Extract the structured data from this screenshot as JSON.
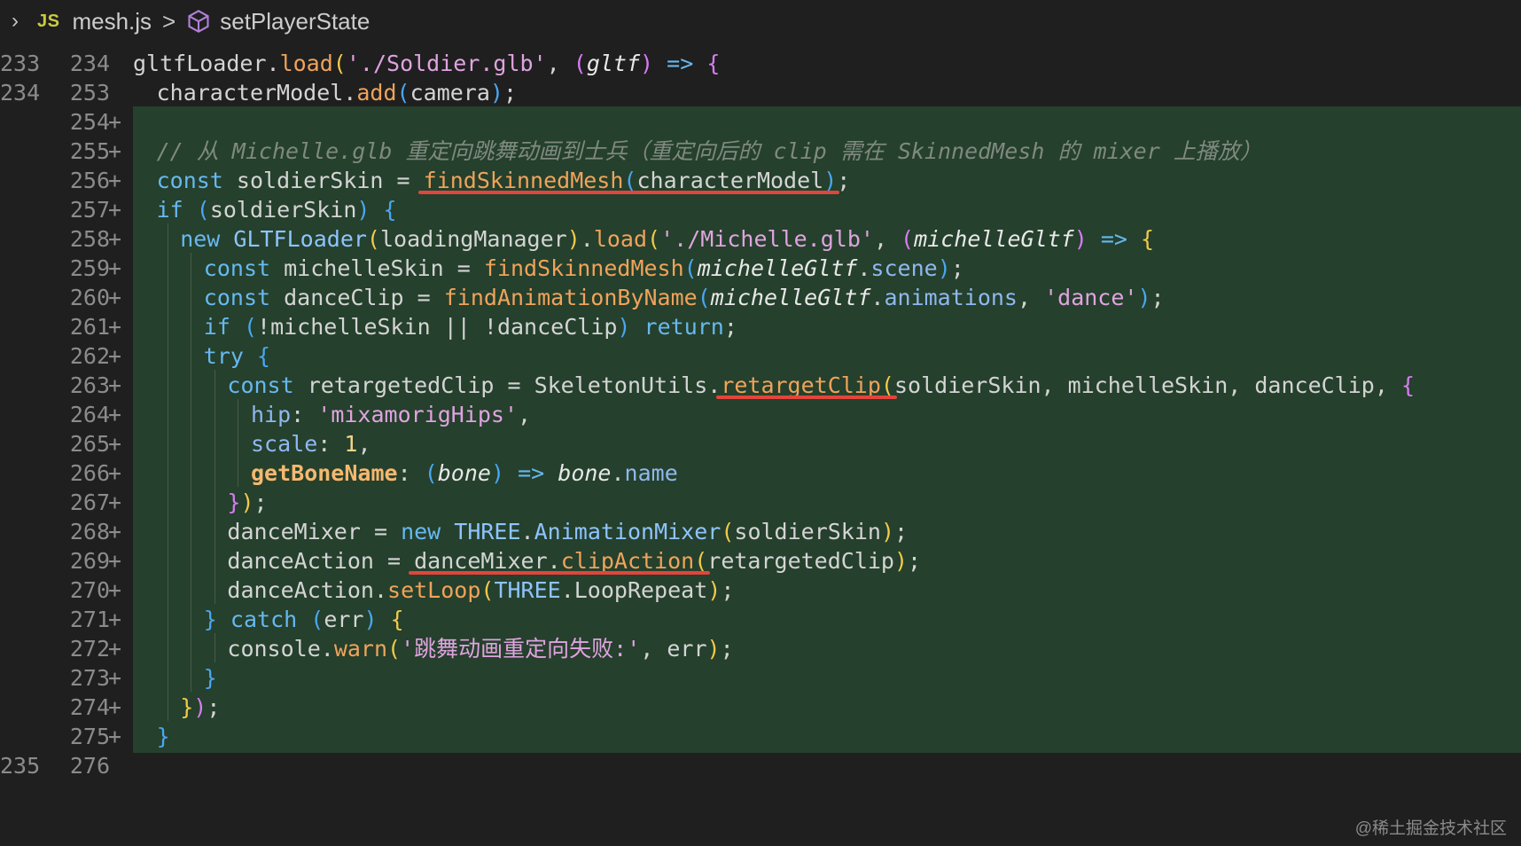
{
  "breadcrumb": {
    "file_badge": "JS",
    "file_name": "mesh.js",
    "separator": ">",
    "symbol_name": "setPlayerState",
    "symbol_icon": "cube-icon"
  },
  "colors": {
    "added_line_background": "#25402c",
    "annotation_underline": "#e2453c",
    "js_badge": "#cbcb41"
  },
  "lines": [
    {
      "old": "233",
      "new": "234",
      "plus": "",
      "added": false,
      "indent": 0,
      "tokens": [
        [
          "t-plain",
          "gltfLoader."
        ],
        [
          "t-method",
          "load"
        ],
        [
          "t-paren1",
          "("
        ],
        [
          "t-string",
          "'./Soldier.glb'"
        ],
        [
          "t-plain",
          ", "
        ],
        [
          "t-paren2",
          "("
        ],
        [
          "t-param",
          "gltf"
        ],
        [
          "t-paren2",
          ")"
        ],
        [
          "t-plain",
          " "
        ],
        [
          "t-kw",
          "=>"
        ],
        [
          "t-plain",
          " "
        ],
        [
          "t-paren2",
          "{"
        ]
      ]
    },
    {
      "old": "234",
      "new": "253",
      "plus": "",
      "added": false,
      "indent": 1,
      "tokens": [
        [
          "t-plain",
          "characterModel."
        ],
        [
          "t-method",
          "add"
        ],
        [
          "t-paren3",
          "("
        ],
        [
          "t-plain",
          "camera"
        ],
        [
          "t-paren3",
          ")"
        ],
        [
          "t-plain",
          ";"
        ]
      ]
    },
    {
      "old": "",
      "new": "254",
      "plus": "+",
      "added": true,
      "indent": 0,
      "tokens": []
    },
    {
      "old": "",
      "new": "255",
      "plus": "+",
      "added": true,
      "indent": 1,
      "tokens": [
        [
          "t-comment",
          "// 从 Michelle.glb 重定向跳舞动画到士兵（重定向后的 clip 需在 SkinnedMesh 的 mixer 上播放）"
        ]
      ]
    },
    {
      "old": "",
      "new": "256",
      "plus": "+",
      "added": true,
      "indent": 1,
      "tokens": [
        [
          "t-kw",
          "const"
        ],
        [
          "t-plain",
          " soldierSkin = "
        ],
        [
          "t-method",
          "findSkinnedMesh"
        ],
        [
          "t-paren3",
          "("
        ],
        [
          "t-plain",
          "characterModel"
        ],
        [
          "t-paren3",
          ")"
        ],
        [
          "t-plain",
          ";"
        ]
      ]
    },
    {
      "old": "",
      "new": "257",
      "plus": "+",
      "added": true,
      "indent": 1,
      "tokens": [
        [
          "t-kw",
          "if"
        ],
        [
          "t-plain",
          " "
        ],
        [
          "t-paren3",
          "("
        ],
        [
          "t-plain",
          "soldierSkin"
        ],
        [
          "t-paren3",
          ")"
        ],
        [
          "t-plain",
          " "
        ],
        [
          "t-paren3",
          "{"
        ]
      ]
    },
    {
      "old": "",
      "new": "258",
      "plus": "+",
      "added": true,
      "indent": 2,
      "tokens": [
        [
          "t-kw",
          "new"
        ],
        [
          "t-plain",
          " "
        ],
        [
          "t-class",
          "GLTFLoader"
        ],
        [
          "t-paren1",
          "("
        ],
        [
          "t-plain",
          "loadingManager"
        ],
        [
          "t-paren1",
          ")"
        ],
        [
          "t-plain",
          "."
        ],
        [
          "t-method",
          "load"
        ],
        [
          "t-paren1",
          "("
        ],
        [
          "t-string",
          "'./Michelle.glb'"
        ],
        [
          "t-plain",
          ", "
        ],
        [
          "t-paren2",
          "("
        ],
        [
          "t-param",
          "michelleGltf"
        ],
        [
          "t-paren2",
          ")"
        ],
        [
          "t-plain",
          " "
        ],
        [
          "t-kw",
          "=>"
        ],
        [
          "t-plain",
          " "
        ],
        [
          "t-paren1",
          "{"
        ]
      ]
    },
    {
      "old": "",
      "new": "259",
      "plus": "+",
      "added": true,
      "indent": 3,
      "tokens": [
        [
          "t-kw",
          "const"
        ],
        [
          "t-plain",
          " michelleSkin = "
        ],
        [
          "t-method",
          "findSkinnedMesh"
        ],
        [
          "t-paren3",
          "("
        ],
        [
          "t-param",
          "michelleGltf"
        ],
        [
          "t-plain",
          "."
        ],
        [
          "t-prop",
          "scene"
        ],
        [
          "t-paren3",
          ")"
        ],
        [
          "t-plain",
          ";"
        ]
      ]
    },
    {
      "old": "",
      "new": "260",
      "plus": "+",
      "added": true,
      "indent": 3,
      "tokens": [
        [
          "t-kw",
          "const"
        ],
        [
          "t-plain",
          " danceClip = "
        ],
        [
          "t-method",
          "findAnimationByName"
        ],
        [
          "t-paren3",
          "("
        ],
        [
          "t-param",
          "michelleGltf"
        ],
        [
          "t-plain",
          "."
        ],
        [
          "t-prop",
          "animations"
        ],
        [
          "t-plain",
          ", "
        ],
        [
          "t-string",
          "'dance'"
        ],
        [
          "t-paren3",
          ")"
        ],
        [
          "t-plain",
          ";"
        ]
      ]
    },
    {
      "old": "",
      "new": "261",
      "plus": "+",
      "added": true,
      "indent": 3,
      "tokens": [
        [
          "t-kw",
          "if"
        ],
        [
          "t-plain",
          " "
        ],
        [
          "t-paren3",
          "("
        ],
        [
          "t-plain",
          "!michelleSkin || !danceClip"
        ],
        [
          "t-paren3",
          ")"
        ],
        [
          "t-plain",
          " "
        ],
        [
          "t-kw",
          "return"
        ],
        [
          "t-plain",
          ";"
        ]
      ]
    },
    {
      "old": "",
      "new": "262",
      "plus": "+",
      "added": true,
      "indent": 3,
      "tokens": [
        [
          "t-kw",
          "try"
        ],
        [
          "t-plain",
          " "
        ],
        [
          "t-paren3",
          "{"
        ]
      ]
    },
    {
      "old": "",
      "new": "263",
      "plus": "+",
      "added": true,
      "indent": 4,
      "tokens": [
        [
          "t-kw",
          "const"
        ],
        [
          "t-plain",
          " retargetedClip = SkeletonUtils."
        ],
        [
          "t-method",
          "retargetClip"
        ],
        [
          "t-paren1",
          "("
        ],
        [
          "t-plain",
          "soldierSkin, michelleSkin, danceClip, "
        ],
        [
          "t-paren2",
          "{"
        ]
      ]
    },
    {
      "old": "",
      "new": "264",
      "plus": "+",
      "added": true,
      "indent": 5,
      "tokens": [
        [
          "t-prop",
          "hip"
        ],
        [
          "t-plain",
          ": "
        ],
        [
          "t-string",
          "'mixamorigHips'"
        ],
        [
          "t-plain",
          ","
        ]
      ]
    },
    {
      "old": "",
      "new": "265",
      "plus": "+",
      "added": true,
      "indent": 5,
      "tokens": [
        [
          "t-prop",
          "scale"
        ],
        [
          "t-plain",
          ": "
        ],
        [
          "t-number",
          "1"
        ],
        [
          "t-plain",
          ","
        ]
      ]
    },
    {
      "old": "",
      "new": "266",
      "plus": "+",
      "added": true,
      "indent": 5,
      "tokens": [
        [
          "t-boldkey",
          "getBoneName"
        ],
        [
          "t-plain",
          ": "
        ],
        [
          "t-paren3",
          "("
        ],
        [
          "t-param",
          "bone"
        ],
        [
          "t-paren3",
          ")"
        ],
        [
          "t-plain",
          " "
        ],
        [
          "t-kw",
          "=>"
        ],
        [
          "t-plain",
          " "
        ],
        [
          "t-param",
          "bone"
        ],
        [
          "t-plain",
          "."
        ],
        [
          "t-prop",
          "name"
        ]
      ]
    },
    {
      "old": "",
      "new": "267",
      "plus": "+",
      "added": true,
      "indent": 4,
      "tokens": [
        [
          "t-paren2",
          "}"
        ],
        [
          "t-paren1",
          ")"
        ],
        [
          "t-plain",
          ";"
        ]
      ]
    },
    {
      "old": "",
      "new": "268",
      "plus": "+",
      "added": true,
      "indent": 4,
      "tokens": [
        [
          "t-plain",
          "danceMixer = "
        ],
        [
          "t-kw",
          "new"
        ],
        [
          "t-plain",
          " "
        ],
        [
          "t-class",
          "THREE"
        ],
        [
          "t-plain",
          "."
        ],
        [
          "t-class",
          "AnimationMixer"
        ],
        [
          "t-paren1",
          "("
        ],
        [
          "t-plain",
          "soldierSkin"
        ],
        [
          "t-paren1",
          ")"
        ],
        [
          "t-plain",
          ";"
        ]
      ]
    },
    {
      "old": "",
      "new": "269",
      "plus": "+",
      "added": true,
      "indent": 4,
      "tokens": [
        [
          "t-plain",
          "danceAction = danceMixer."
        ],
        [
          "t-method",
          "clipAction"
        ],
        [
          "t-paren1",
          "("
        ],
        [
          "t-plain",
          "retargetedClip"
        ],
        [
          "t-paren1",
          ")"
        ],
        [
          "t-plain",
          ";"
        ]
      ]
    },
    {
      "old": "",
      "new": "270",
      "plus": "+",
      "added": true,
      "indent": 4,
      "tokens": [
        [
          "t-plain",
          "danceAction."
        ],
        [
          "t-method",
          "setLoop"
        ],
        [
          "t-paren1",
          "("
        ],
        [
          "t-class",
          "THREE"
        ],
        [
          "t-plain",
          ".LoopRepeat"
        ],
        [
          "t-paren1",
          ")"
        ],
        [
          "t-plain",
          ";"
        ]
      ]
    },
    {
      "old": "",
      "new": "271",
      "plus": "+",
      "added": true,
      "indent": 3,
      "tokens": [
        [
          "t-paren3",
          "}"
        ],
        [
          "t-plain",
          " "
        ],
        [
          "t-kw",
          "catch"
        ],
        [
          "t-plain",
          " "
        ],
        [
          "t-paren3",
          "("
        ],
        [
          "t-plain",
          "err"
        ],
        [
          "t-paren3",
          ")"
        ],
        [
          "t-plain",
          " "
        ],
        [
          "t-paren1",
          "{"
        ]
      ]
    },
    {
      "old": "",
      "new": "272",
      "plus": "+",
      "added": true,
      "indent": 4,
      "tokens": [
        [
          "t-plain",
          "console."
        ],
        [
          "t-method",
          "warn"
        ],
        [
          "t-paren1",
          "("
        ],
        [
          "t-string",
          "'跳舞动画重定向失败:'"
        ],
        [
          "t-plain",
          ", err"
        ],
        [
          "t-paren1",
          ")"
        ],
        [
          "t-plain",
          ";"
        ]
      ]
    },
    {
      "old": "",
      "new": "273",
      "plus": "+",
      "added": true,
      "indent": 3,
      "tokens": [
        [
          "t-paren3",
          "}"
        ]
      ]
    },
    {
      "old": "",
      "new": "274",
      "plus": "+",
      "added": true,
      "indent": 2,
      "tokens": [
        [
          "t-paren1",
          "}"
        ],
        [
          "t-paren2",
          ")"
        ],
        [
          "t-plain",
          ";"
        ]
      ]
    },
    {
      "old": "",
      "new": "275",
      "plus": "+",
      "added": true,
      "indent": 1,
      "tokens": [
        [
          "t-paren3",
          "}"
        ]
      ]
    },
    {
      "old": "235",
      "new": "276",
      "plus": "",
      "added": false,
      "indent": 0,
      "tokens": []
    }
  ],
  "annotations": [
    {
      "name": "underline-findskinnedmesh",
      "line": 4,
      "text_match": "findSkinnedMesh(characterModel)"
    },
    {
      "name": "underline-retargetclip",
      "line": 11,
      "text_match": "retargetClip("
    },
    {
      "name": "underline-clipaction",
      "line": 17,
      "text_match": "danceMixer.clipAction("
    }
  ],
  "watermark": "@稀土掘金技术社区"
}
